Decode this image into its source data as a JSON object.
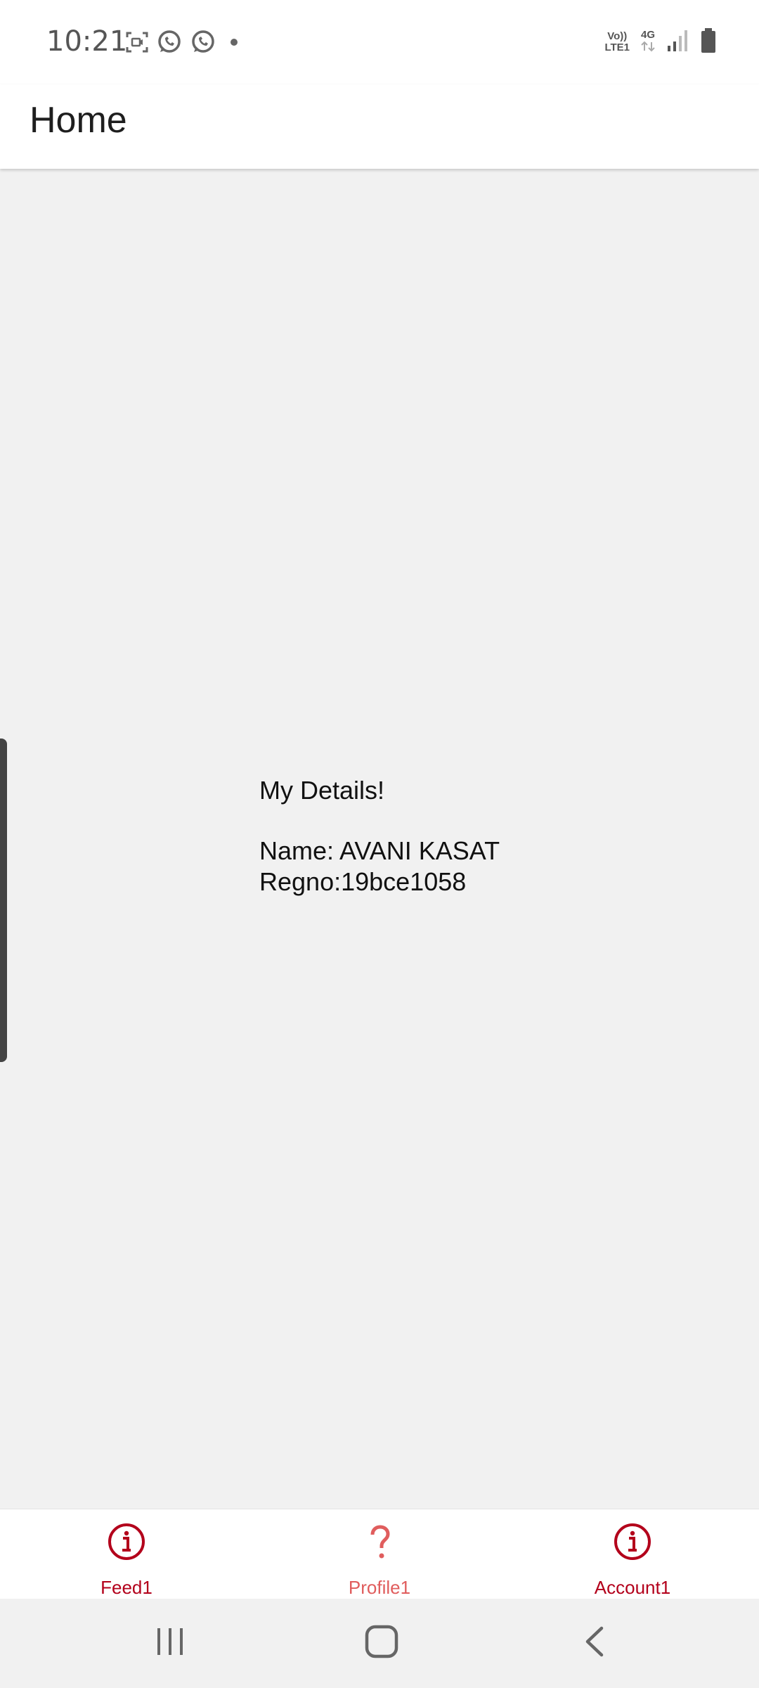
{
  "status_bar": {
    "time": "10:21",
    "volte_line1": "Vo))",
    "volte_line2": "LTE1",
    "network": "4G",
    "icons": [
      "screen-record-icon",
      "whatsapp-icon",
      "whatsapp-icon",
      "dot-icon",
      "signal-icon",
      "battery-icon"
    ]
  },
  "app_bar": {
    "title": "Home"
  },
  "content": {
    "heading": "My Details!",
    "name_line": "Name: AVANI KASAT",
    "regno_line": "Regno:19bce1058"
  },
  "bottom_nav": {
    "items": [
      {
        "label": "Feed1",
        "icon": "info-circle-icon"
      },
      {
        "label": "Profile1",
        "icon": "question-mark-icon"
      },
      {
        "label": "Account1",
        "icon": "info-circle-icon"
      }
    ]
  },
  "colors": {
    "accent": "#b3001b",
    "accent_light": "#e05d5d",
    "background": "#f1f1f1"
  }
}
